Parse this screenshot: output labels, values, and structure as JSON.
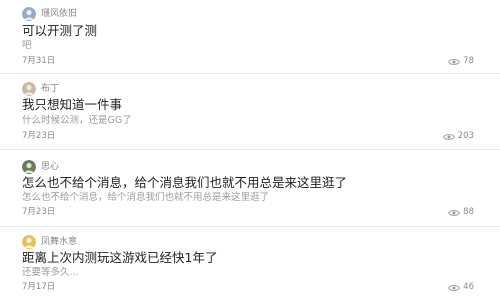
{
  "posts": [
    {
      "author": "珊风依旧",
      "avatar_color": "#9aa9c4",
      "title": "可以开测了测",
      "excerpt": "吧",
      "date": "7月31日",
      "views": "78"
    },
    {
      "author": "布丁",
      "avatar_color": "#c9b8a3",
      "title": "我只想知道一件事",
      "excerpt": "什么时候公测，还是GG了",
      "date": "7月23日",
      "views": "203"
    },
    {
      "author": "思心",
      "avatar_color": "#6d7a5c",
      "title": "怎么也不给个消息，给个消息我们也就不用总是来这里逛了",
      "excerpt": "怎么也不给个消息，给个消息我们也就不用总是来这里逛了",
      "date": "7月23日",
      "views": "88"
    },
    {
      "author": "凤舞水意",
      "avatar_color": "#e8c05a",
      "title": "距离上次内测玩这游戏已经快1年了",
      "excerpt": "还要等多久...",
      "date": "7月17日",
      "views": "46"
    }
  ],
  "icons": {
    "avatar": "avatar-icon",
    "views": "eye-icon"
  },
  "colors": {
    "title": "#222222",
    "meta": "#8a8a8a",
    "divider": "#ececec"
  }
}
